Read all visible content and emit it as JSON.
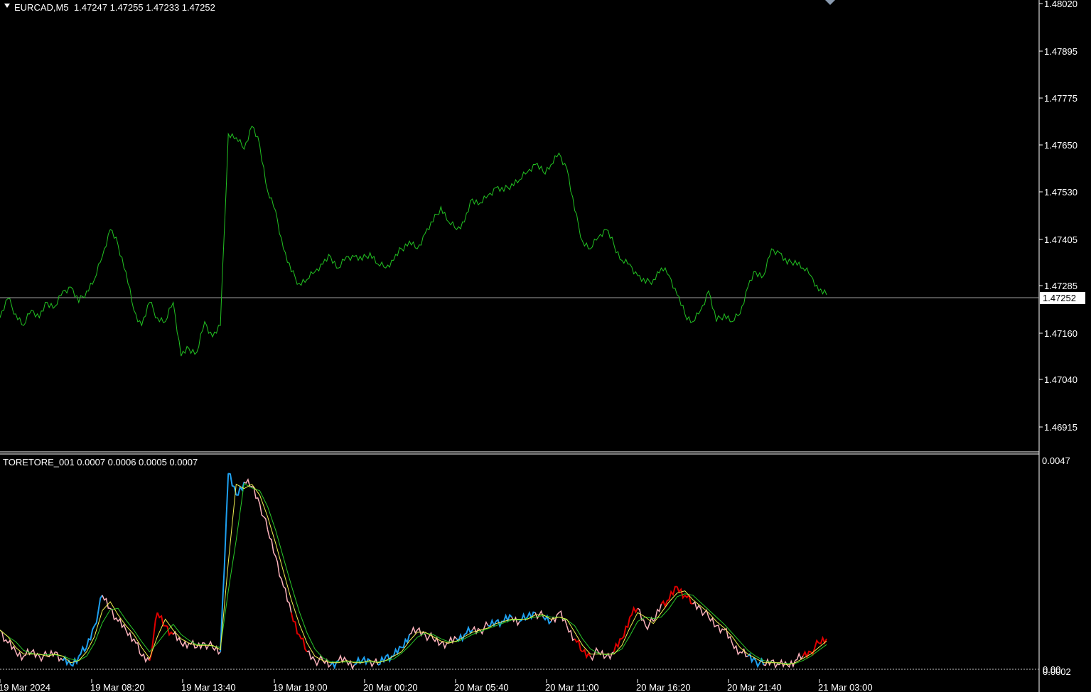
{
  "main_chart": {
    "symbol_label": "EURCAD,M5",
    "ohlc_label": "1.47247 1.47255 1.47233 1.47252",
    "current_price_label": "1.47252",
    "y_ticks": [
      "1.48020",
      "1.47895",
      "1.47775",
      "1.47650",
      "1.47530",
      "1.47405",
      "1.47285",
      "1.47160",
      "1.47040",
      "1.46915"
    ],
    "line_color": "#22c322",
    "price_range": [
      1.4685,
      1.4802
    ],
    "close_series": [
      1.472,
      1.4725,
      1.4721,
      1.4718,
      1.4722,
      1.472,
      1.4724,
      1.4723,
      1.4727,
      1.4728,
      1.4724,
      1.4727,
      1.473,
      1.4736,
      1.4743,
      1.4739,
      1.4732,
      1.4722,
      1.4718,
      1.4724,
      1.472,
      1.4719,
      1.4724,
      1.471,
      1.4712,
      1.4711,
      1.4719,
      1.4715,
      1.4718,
      1.4768,
      1.4767,
      1.4764,
      1.477,
      1.4765,
      1.4753,
      1.4748,
      1.4738,
      1.4732,
      1.4729,
      1.473,
      1.4732,
      1.4734,
      1.4736,
      1.4733,
      1.4736,
      1.4736,
      1.4735,
      1.4737,
      1.4734,
      1.4733,
      1.4735,
      1.4738,
      1.474,
      1.4738,
      1.4742,
      1.4745,
      1.4749,
      1.4745,
      1.4743,
      1.4745,
      1.4751,
      1.475,
      1.4752,
      1.4754,
      1.4753,
      1.4755,
      1.4756,
      1.4758,
      1.476,
      1.4758,
      1.476,
      1.4763,
      1.4759,
      1.4748,
      1.474,
      1.4738,
      1.4741,
      1.4743,
      1.4739,
      1.4735,
      1.4734,
      1.4731,
      1.4729,
      1.473,
      1.4733,
      1.4731,
      1.4726,
      1.4721,
      1.4719,
      1.4722,
      1.4727,
      1.4719,
      1.4721,
      1.4719,
      1.4721,
      1.4728,
      1.4732,
      1.4731,
      1.4738,
      1.4737,
      1.4734,
      1.4735,
      1.4733,
      1.4731,
      1.4727,
      1.4726
    ]
  },
  "indicator": {
    "label": "TORETORE_001 0.0007 0.0006 0.0005 0.0007",
    "y_ticks": [
      "0.0047",
      "0.0002",
      "0.00"
    ],
    "value_range": [
      0.0,
      0.0047
    ],
    "colors": {
      "up": "#1ea0f0",
      "down": "#e00000",
      "neutral": "#ffb4be",
      "ma_fast": "#f0f050",
      "ma_slow": "#28c828"
    },
    "main_series": [
      0.0009,
      0.0006,
      0.0004,
      0.0003,
      0.0004,
      0.0003,
      0.0003,
      0.0004,
      0.0002,
      0.0001,
      0.0003,
      0.0005,
      0.001,
      0.0017,
      0.0014,
      0.0011,
      0.0009,
      0.0007,
      0.0003,
      0.0002,
      0.0013,
      0.001,
      0.0008,
      0.0006,
      0.0006,
      0.0005,
      0.0006,
      0.0005,
      0.0004,
      0.0045,
      0.004,
      0.0043,
      0.0042,
      0.0038,
      0.0032,
      0.0026,
      0.0019,
      0.0013,
      0.0008,
      0.0004,
      0.0002,
      0.0002,
      0.0001,
      0.0002,
      0.0002,
      0.0001,
      0.0002,
      0.0002,
      0.0001,
      0.0003,
      0.0003,
      0.0005,
      0.0008,
      0.0009,
      0.0008,
      0.0007,
      0.0006,
      0.0006,
      0.0007,
      0.0008,
      0.0009,
      0.0009,
      0.001,
      0.0011,
      0.0011,
      0.0012,
      0.0011,
      0.0012,
      0.0013,
      0.0012,
      0.0011,
      0.0013,
      0.001,
      0.0007,
      0.0004,
      0.0003,
      0.0004,
      0.0003,
      0.0004,
      0.0007,
      0.0012,
      0.0014,
      0.001,
      0.0011,
      0.0015,
      0.0016,
      0.0019,
      0.0017,
      0.0015,
      0.0014,
      0.0012,
      0.001,
      0.0009,
      0.0006,
      0.0004,
      0.0003,
      0.0002,
      0.0001,
      0.0002,
      0.0001,
      0.0001,
      0.0002,
      0.0003,
      0.0004,
      0.0006,
      0.0007
    ],
    "colors_series": [
      "n",
      "n",
      "n",
      "n",
      "n",
      "n",
      "n",
      "n",
      "n",
      "u",
      "u",
      "u",
      "u",
      "u",
      "n",
      "n",
      "n",
      "n",
      "n",
      "n",
      "d",
      "d",
      "d",
      "n",
      "n",
      "n",
      "n",
      "n",
      "n",
      "u",
      "u",
      "u",
      "n",
      "n",
      "n",
      "n",
      "n",
      "n",
      "d",
      "d",
      "n",
      "n",
      "n",
      "u",
      "n",
      "n",
      "u",
      "u",
      "n",
      "u",
      "u",
      "u",
      "u",
      "n",
      "n",
      "n",
      "n",
      "n",
      "n",
      "u",
      "u",
      "n",
      "n",
      "u",
      "u",
      "u",
      "n",
      "u",
      "u",
      "n",
      "u",
      "n",
      "n",
      "n",
      "d",
      "d",
      "n",
      "n",
      "n",
      "d",
      "d",
      "d",
      "n",
      "n",
      "n",
      "d",
      "d",
      "d",
      "d",
      "n",
      "n",
      "n",
      "n",
      "n",
      "n",
      "n",
      "u",
      "u",
      "n",
      "n",
      "n",
      "n",
      "n",
      "d",
      "d",
      "d"
    ]
  },
  "time_axis": {
    "labels": [
      "19 Mar 2024",
      "19 Mar 08:20",
      "19 Mar 13:40",
      "19 Mar 19:00",
      "20 Mar 00:20",
      "20 Mar 05:40",
      "20 Mar 11:00",
      "20 Mar 16:20",
      "20 Mar 21:40",
      "21 Mar 03:00"
    ]
  }
}
